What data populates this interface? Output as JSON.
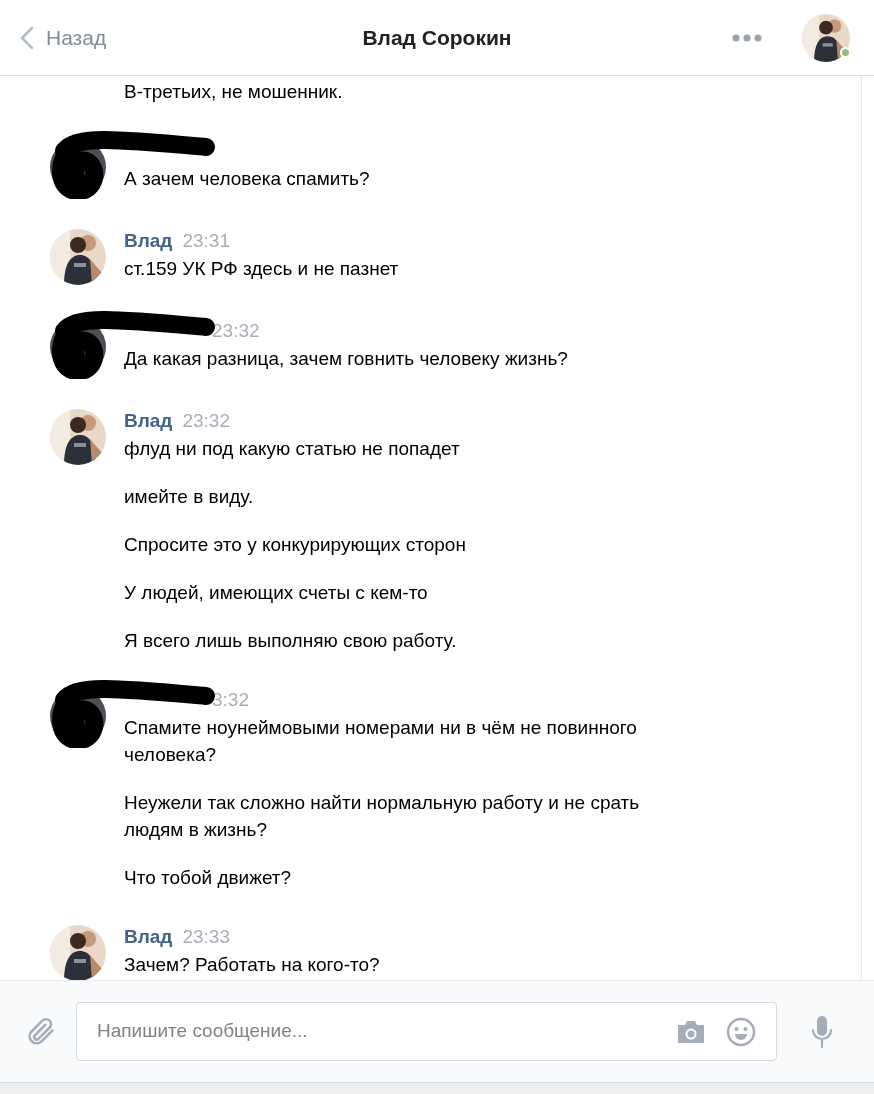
{
  "header": {
    "back_label": "Назад",
    "title": "Влад Сорокин",
    "online": true
  },
  "messages": [
    {
      "kind": "continuation",
      "lines": [
        "В-третьих, не мошенник."
      ]
    },
    {
      "kind": "redacted",
      "lines": [
        "А зачем человека спамить?"
      ]
    },
    {
      "kind": "named",
      "sender": "Влад",
      "time": "23:31",
      "lines": [
        "ст.159 УК РФ здесь и не пазнет"
      ]
    },
    {
      "kind": "redacted",
      "time": "23:32",
      "lines": [
        "Да какая разница, зачем говнить человеку жизнь?"
      ]
    },
    {
      "kind": "named",
      "sender": "Влад",
      "time": "23:32",
      "lines": [
        "флуд ни под какую статью не попадет",
        "имейте в виду.",
        "Спросите это у конкурирующих сторон",
        "У людей, имеющих счеты с кем-то",
        "Я всего лишь выполняю свою работу."
      ]
    },
    {
      "kind": "redacted",
      "time": "3:32",
      "lines": [
        "Спамите ноунеймовыми номерами ни в чём не повинного человека?",
        "Неужели так сложно найти нормальную работу и не срать людям в жизнь?",
        "Что тобой движет?"
      ]
    },
    {
      "kind": "named",
      "sender": "Влад",
      "time": "23:33",
      "lines": [
        "Зачем? Работать на кого-то?"
      ]
    }
  ],
  "composer": {
    "placeholder": "Напишите сообщение..."
  }
}
